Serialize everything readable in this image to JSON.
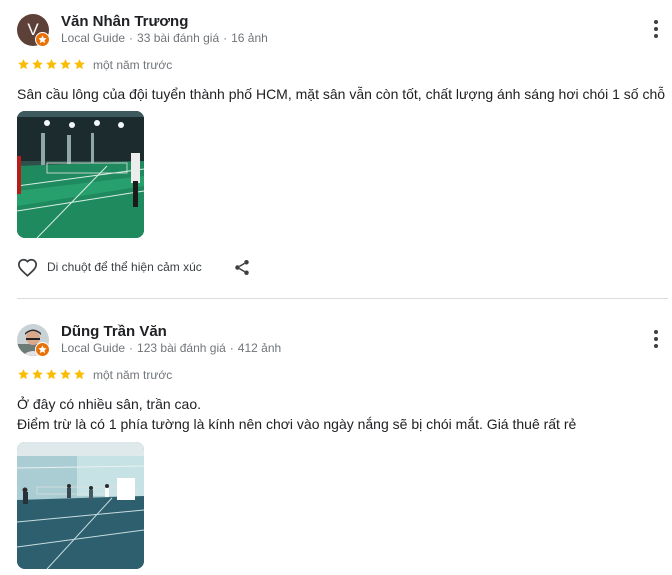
{
  "reviews": [
    {
      "avatar_letter": "V",
      "name": "Văn Nhân Trương",
      "badge": "Local Guide",
      "review_count": "33 bài đánh giá",
      "photo_count": "16 ảnh",
      "rating": 5,
      "date": "một năm trước",
      "text_lines": [
        "Sân cầu lông của đội tuyển thành phố HCM, mặt sân vẫn còn tốt, chất lượng ánh sáng hơi chói 1 số chỗ"
      ],
      "react_label": "Di chuột để thể hiện cảm xúc"
    },
    {
      "avatar_letter": "",
      "name": "Dũng Trần Văn",
      "badge": "Local Guide",
      "review_count": "123 bài đánh giá",
      "photo_count": "412 ảnh",
      "rating": 5,
      "date": "một năm trước",
      "text_lines": [
        "Ở đây có nhiều sân, trần cao.",
        "Điểm trừ là có 1 phía tường là kính nên chơi vào ngày nắng sẽ bị chói mắt. Giá thuê rất rẻ"
      ]
    }
  ],
  "colors": {
    "star": "#fbbc04",
    "badge": "#e8710a",
    "meta_text": "#70757a",
    "divider": "#dadce0"
  },
  "icons": {
    "menu": "more-vert-icon",
    "react": "heart-outline-icon",
    "share": "share-icon",
    "badge": "local-guide-star-icon"
  }
}
